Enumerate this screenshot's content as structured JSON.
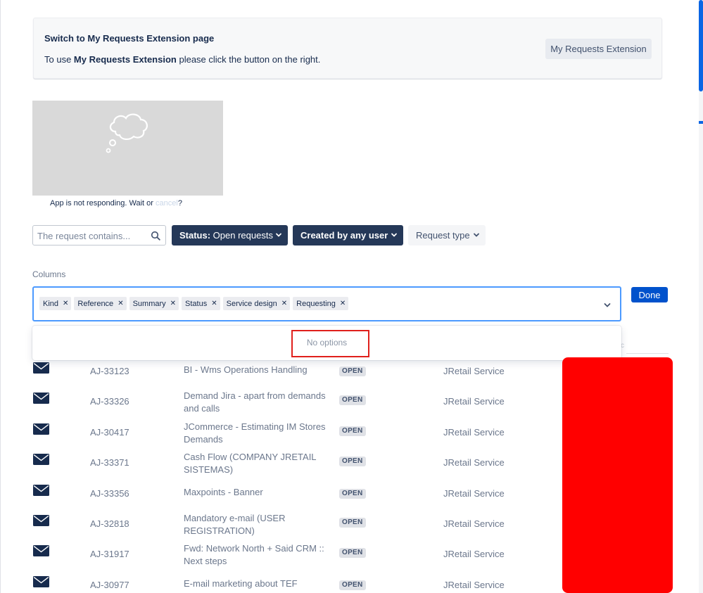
{
  "banner": {
    "title": "Switch to My Requests Extension page",
    "text_before": "To use ",
    "text_bold": "My Requests Extension",
    "text_after": " please click the button on the right.",
    "button_label": "My Requests Extension"
  },
  "app_placeholder": {
    "message_before": "App is not responding. Wait or ",
    "cancel_label": "cancel",
    "message_after": "?"
  },
  "filters": {
    "search_placeholder": "The request contains...",
    "status_prefix": "Status:",
    "status_value": " Open requests",
    "created_label": "Created by any user",
    "request_type_label": "Request type"
  },
  "columns": {
    "label": "Columns",
    "tags": [
      "Kind",
      "Reference",
      "Summary",
      "Status",
      "Service design",
      "Requesting"
    ],
    "done_label": "Done",
    "empty_text": "No options"
  },
  "rows": [
    {
      "ref": "AJ-33123",
      "summary": "BI - Wms Operations Handling",
      "status": "OPEN",
      "service": "JRetail Service"
    },
    {
      "ref": "AJ-33326",
      "summary": "Demand Jira - apart from demands and calls",
      "status": "OPEN",
      "service": "JRetail Service"
    },
    {
      "ref": "AJ-30417",
      "summary": "JCommerce - Estimating IM Stores Demands",
      "status": "OPEN",
      "service": "JRetail Service"
    },
    {
      "ref": "AJ-33371",
      "summary": "Cash Flow (COMPANY JRETAIL SISTEMAS)",
      "status": "OPEN",
      "service": "JRetail Service"
    },
    {
      "ref": "AJ-33356",
      "summary": "Maxpoints - Banner",
      "status": "OPEN",
      "service": "JRetail Service"
    },
    {
      "ref": "AJ-32818",
      "summary": "Mandatory e-mail (USER REGISTRATION)",
      "status": "OPEN",
      "service": "JRetail Service"
    },
    {
      "ref": "AJ-31917",
      "summary": "Fwd: Network North + Said CRM :: Next steps",
      "status": "OPEN",
      "service": "JRetail Service"
    },
    {
      "ref": "AJ-30977",
      "summary": "E-mail marketing about TEF",
      "status": "OPEN",
      "service": "JRetail Service"
    }
  ],
  "icons": {
    "row_kind": "envelope-icon",
    "search": "search-icon",
    "dropdown": "chevron-down-icon",
    "placeholder": "thought-cloud-icon"
  },
  "colors": {
    "dark_filter": "#253858",
    "primary": "#0052cc",
    "focus_border": "#4c9aff",
    "annotation_red": "#e0201c",
    "redaction": "#ff0000"
  }
}
